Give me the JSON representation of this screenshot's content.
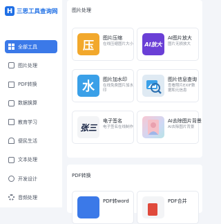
{
  "brand": {
    "logo_mark": "H",
    "name": "三思工具查询网"
  },
  "sidebar": {
    "items": [
      {
        "label": "全部工具",
        "icon": "grid-icon",
        "active": true
      },
      {
        "label": "图片处理",
        "icon": "image-icon"
      },
      {
        "label": "PDF转换",
        "icon": "pdf-icon"
      },
      {
        "label": "数据换算",
        "icon": "calculator-icon"
      },
      {
        "label": "教育学习",
        "icon": "book-icon"
      },
      {
        "label": "便民生活",
        "icon": "home-icon"
      },
      {
        "label": "文本处理",
        "icon": "text-icon"
      },
      {
        "label": "开发设计",
        "icon": "code-icon"
      },
      {
        "label": "音频处理",
        "icon": "audio-icon"
      }
    ]
  },
  "sections": [
    {
      "title": "图片处理",
      "cards": [
        {
          "title": "图片压缩",
          "desc": "在线压缩图片大小",
          "icon": "compress-icon",
          "glyph": "压"
        },
        {
          "title": "AI图片放大",
          "desc": "图片无损放大",
          "icon": "ai-enlarge-icon",
          "glyph": "AI放大"
        },
        {
          "title": "图片加水印",
          "desc": "在线免费图片加水印",
          "icon": "watermark-icon",
          "glyph": "水"
        },
        {
          "title": "图片信息查询",
          "desc": "查看照片EXIF数据和元信息",
          "icon": "image-info-icon",
          "glyph": ""
        },
        {
          "title": "电子签名",
          "desc": "电子签名在线制作",
          "icon": "signature-icon",
          "glyph": "张三"
        },
        {
          "title": "AI去除图片背景",
          "desc": "AI去除图片背景",
          "icon": "remove-bg-icon",
          "glyph": ""
        }
      ]
    },
    {
      "title": "PDF转换",
      "cards": [
        {
          "title": "PDF转word",
          "desc": "",
          "icon": "pdf-word-icon",
          "glyph": ""
        },
        {
          "title": "PDF合并",
          "desc": "",
          "icon": "pdf-merge-icon",
          "glyph": ""
        }
      ]
    }
  ],
  "colors": {
    "accent": "#3b79e8",
    "brand": "#1f6fe5"
  }
}
